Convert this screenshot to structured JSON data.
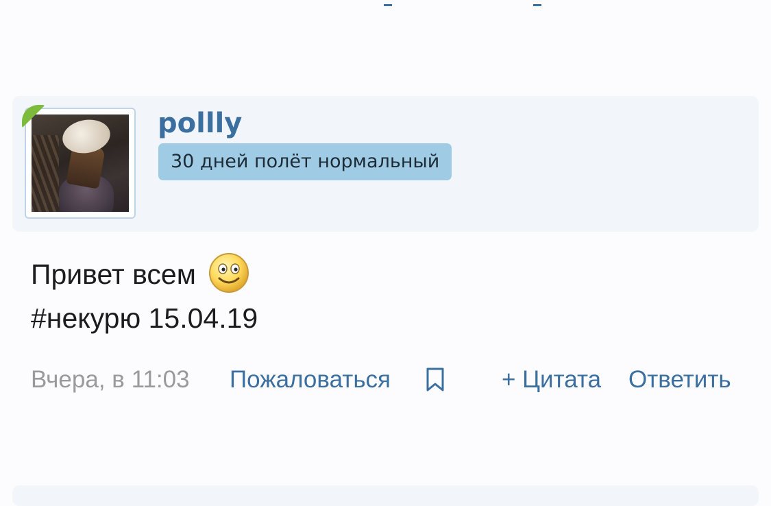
{
  "post": {
    "author": {
      "username": "pollly",
      "title": "30 дней полёт нормальный",
      "online": true
    },
    "body": {
      "line1": "Привет всем",
      "line2": "#некурю 15.04.19",
      "emoji": "smiley-icon"
    },
    "footer": {
      "date": "Вчера, в 11:03",
      "report_label": "Пожаловаться",
      "bookmark_icon": "bookmark-icon",
      "quote_label": "+ Цитата",
      "reply_label": "Ответить"
    }
  },
  "colors": {
    "link": "#3b6fa0",
    "header_bg": "#f2f6fb",
    "title_badge_bg": "#9fcbe4",
    "online_badge": "#7dbb3c",
    "date_text": "#9a9a9a"
  }
}
